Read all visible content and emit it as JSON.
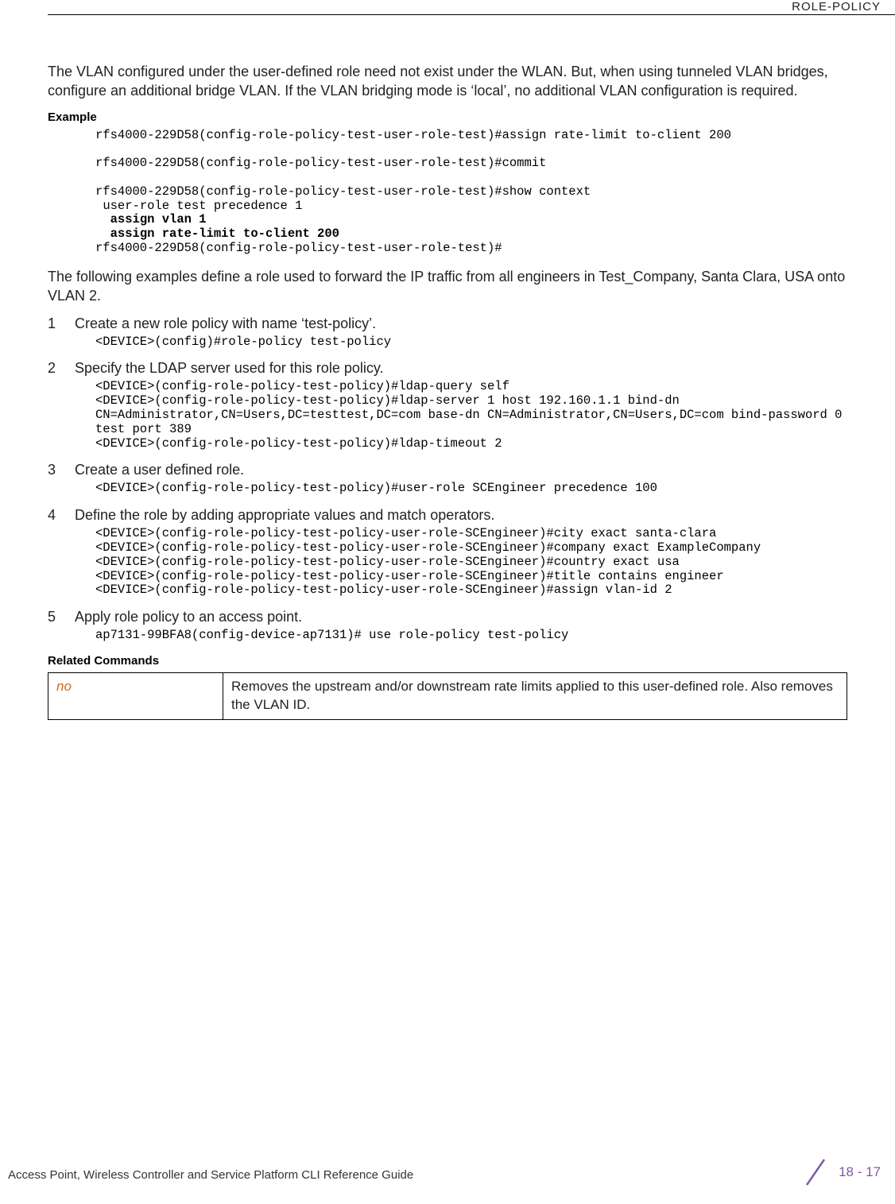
{
  "header": {
    "section": "ROLE-POLICY"
  },
  "intro": "The VLAN configured under the user-defined role need not exist under the WLAN. But, when using tunneled VLAN bridges, configure an additional bridge VLAN. If the VLAN bridging mode is ‘local’, no additional VLAN configuration is required.",
  "labels": {
    "example": "Example",
    "related": "Related Commands"
  },
  "example_code": {
    "l1": "rfs4000-229D58(config-role-policy-test-user-role-test)#assign rate-limit to-client 200",
    "l2": "rfs4000-229D58(config-role-policy-test-user-role-test)#commit",
    "l3": "rfs4000-229D58(config-role-policy-test-user-role-test)#show context",
    "l4": " user-role test precedence 1",
    "l5": "  assign vlan 1",
    "l6": "  assign rate-limit to-client 200",
    "l7": "rfs4000-229D58(config-role-policy-test-user-role-test)#"
  },
  "example_desc": "The following examples define a role used to forward the IP traffic from all engineers in Test_Company, Santa Clara, USA onto VLAN 2.",
  "steps": [
    {
      "num": "1",
      "text": "Create a new role policy with name ‘test-policy’.",
      "code": "<DEVICE>(config)#role-policy test-policy"
    },
    {
      "num": "2",
      "text": "Specify the LDAP server used for this role policy.",
      "code": "<DEVICE>(config-role-policy-test-policy)#ldap-query self\n<DEVICE>(config-role-policy-test-policy)#ldap-server 1 host 192.160.1.1 bind-dn CN=Administrator,CN=Users,DC=testtest,DC=com base-dn CN=Administrator,CN=Users,DC=com bind-password 0 test port 389\n<DEVICE>(config-role-policy-test-policy)#ldap-timeout 2"
    },
    {
      "num": "3",
      "text": "Create a user defined role.",
      "code": "<DEVICE>(config-role-policy-test-policy)#user-role SCEngineer precedence 100"
    },
    {
      "num": "4",
      "text": "Define the role by adding appropriate values and match operators.",
      "code": "<DEVICE>(config-role-policy-test-policy-user-role-SCEngineer)#city exact santa-clara\n<DEVICE>(config-role-policy-test-policy-user-role-SCEngineer)#company exact ExampleCompany\n<DEVICE>(config-role-policy-test-policy-user-role-SCEngineer)#country exact usa\n<DEVICE>(config-role-policy-test-policy-user-role-SCEngineer)#title contains engineer\n<DEVICE>(config-role-policy-test-policy-user-role-SCEngineer)#assign vlan-id 2"
    },
    {
      "num": "5",
      "text": "Apply role policy to an access point.",
      "code": "ap7131-99BFA8(config-device-ap7131)# use role-policy test-policy"
    }
  ],
  "related": {
    "cmd": "no",
    "desc": "Removes the upstream and/or downstream rate limits applied to this user-defined role. Also removes the VLAN ID."
  },
  "footer": {
    "guide": "Access Point, Wireless Controller and Service Platform CLI Reference Guide",
    "page": "18 - 17"
  }
}
